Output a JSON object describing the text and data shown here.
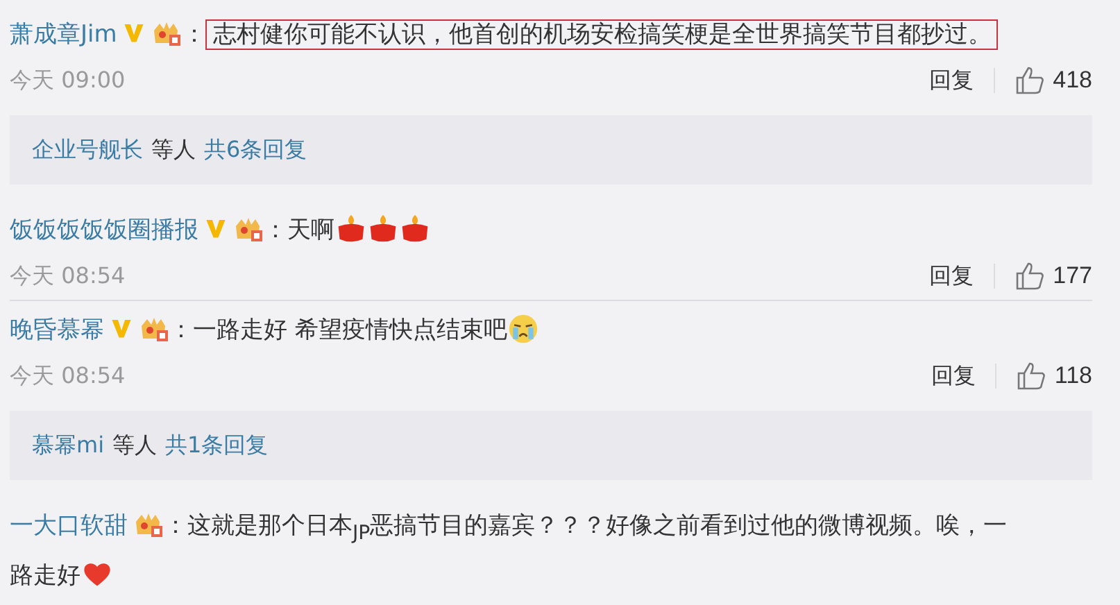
{
  "comments": [
    {
      "user": "萧成章Jim",
      "verified": true,
      "colon": "：",
      "text": "志村健你可能不认识，他首创的机场安检搞笑梗是全世界搞笑节目都抄过。",
      "highlighted": true,
      "time": "今天 09:00",
      "reply": "回复",
      "likes": "418",
      "replies": {
        "users": "企业号舰长",
        "middle": "等人",
        "count": "共6条回复"
      }
    },
    {
      "user": "饭饭饭饭饭圈播报",
      "verified": true,
      "colon": "：",
      "text": "天啊",
      "highlighted": false,
      "emoji": [
        {
          "kind": "candle"
        },
        {
          "kind": "candle"
        },
        {
          "kind": "candle"
        }
      ],
      "time": "今天 08:54",
      "reply": "回复",
      "likes": "177"
    },
    {
      "user": "晚昏慕幂",
      "verified": true,
      "colon": "：",
      "text": "一路走好 希望疫情快点结束吧",
      "highlighted": false,
      "emoji": [
        {
          "kind": "crying"
        }
      ],
      "time": "今天 08:54",
      "reply": "回复",
      "likes": "118",
      "replies": {
        "users": "慕幂mi",
        "middle": "等人",
        "count": "共1条回复"
      }
    },
    {
      "user": "一大口软甜",
      "verified": false,
      "colon": "：",
      "text": "这就是那个日本$_{JP}$恶搞节目的嘉宾？？？好像之前看到过他的微博视频。唉，一",
      "text_continued": "路走好",
      "highlighted": false,
      "emoji": [
        {
          "kind": "heart"
        }
      ]
    }
  ]
}
